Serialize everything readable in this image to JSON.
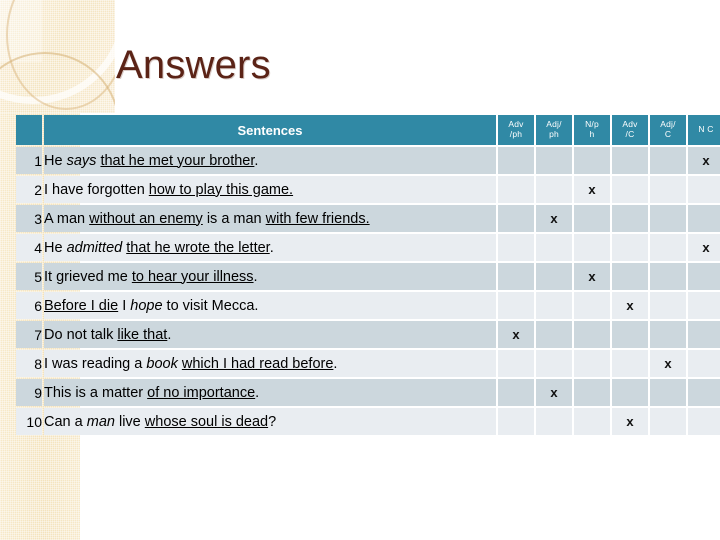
{
  "slide": {
    "title": "Answers",
    "title_color": "#5b2316",
    "accent_color": "#3089a5",
    "row_odd_color": "#ccd7dd",
    "row_even_color": "#e9edf1",
    "deco_color": "#f4e4c0"
  },
  "table": {
    "headers": {
      "number": "",
      "sentences": "Sentences",
      "marks": [
        {
          "line1": "Adv",
          "line2": "/ph",
          "full": "Adv/ph"
        },
        {
          "line1": "Adj/",
          "line2": "ph",
          "full": "Adj/ph"
        },
        {
          "line1": "N/p",
          "line2": "h",
          "full": "N/ph"
        },
        {
          "line1": "Adv",
          "line2": "/C",
          "full": "Adv/C"
        },
        {
          "line1": "Adj/",
          "line2": "C",
          "full": "Adj/C"
        },
        {
          "line1": "N C",
          "line2": "",
          "full": "N C"
        }
      ]
    },
    "mark_symbol": "x",
    "rows": [
      {
        "number": "1",
        "sentence": "He says that he met your brother.",
        "parts": [
          {
            "text": "He ",
            "style": "plain"
          },
          {
            "text": "says",
            "style": "italic"
          },
          {
            "text": " ",
            "style": "plain"
          },
          {
            "text": "that he met your brother",
            "style": "underline"
          },
          {
            "text": ".",
            "style": "plain"
          }
        ],
        "marks": [
          false,
          false,
          false,
          false,
          false,
          true
        ]
      },
      {
        "number": "2",
        "sentence": "I have forgotten how to play this game.",
        "parts": [
          {
            "text": "I have forgotten ",
            "style": "plain"
          },
          {
            "text": "how to play this game.",
            "style": "underline"
          }
        ],
        "marks": [
          false,
          false,
          true,
          false,
          false,
          false
        ]
      },
      {
        "number": "3",
        "sentence": "A man without an enemy is a man with few friends.",
        "parts": [
          {
            "text": "A man ",
            "style": "plain"
          },
          {
            "text": "without an enemy",
            "style": "underline"
          },
          {
            "text": " is a man ",
            "style": "plain"
          },
          {
            "text": "with few friends.",
            "style": "underline"
          }
        ],
        "marks": [
          false,
          true,
          false,
          false,
          false,
          false
        ]
      },
      {
        "number": "4",
        "sentence": "He admitted that he wrote the letter.",
        "parts": [
          {
            "text": "He ",
            "style": "plain"
          },
          {
            "text": "admitted",
            "style": "italic"
          },
          {
            "text": " ",
            "style": "plain"
          },
          {
            "text": "that he wrote the letter",
            "style": "underline"
          },
          {
            "text": ".",
            "style": "plain"
          }
        ],
        "marks": [
          false,
          false,
          false,
          false,
          false,
          true
        ]
      },
      {
        "number": "5",
        "sentence": "It grieved me to hear your illness.",
        "parts": [
          {
            "text": "It grieved me ",
            "style": "plain"
          },
          {
            "text": "to hear your illness",
            "style": "underline"
          },
          {
            "text": ".",
            "style": "plain"
          }
        ],
        "marks": [
          false,
          false,
          true,
          false,
          false,
          false
        ]
      },
      {
        "number": "6",
        "sentence": "Before I die I hope to visit Mecca.",
        "parts": [
          {
            "text": "Before I die",
            "style": "underline"
          },
          {
            "text": " I ",
            "style": "plain"
          },
          {
            "text": "hope",
            "style": "italic"
          },
          {
            "text": " to visit Mecca.",
            "style": "plain"
          }
        ],
        "marks": [
          false,
          false,
          false,
          true,
          false,
          false
        ]
      },
      {
        "number": "7",
        "sentence": "Do not talk like that.",
        "parts": [
          {
            "text": "Do not talk ",
            "style": "plain"
          },
          {
            "text": "like that",
            "style": "underline"
          },
          {
            "text": ".",
            "style": "plain"
          }
        ],
        "marks": [
          true,
          false,
          false,
          false,
          false,
          false
        ]
      },
      {
        "number": "8",
        "sentence": "I was reading a book which I had read before.",
        "parts": [
          {
            "text": "I was reading a ",
            "style": "plain"
          },
          {
            "text": "book",
            "style": "italic"
          },
          {
            "text": " ",
            "style": "plain"
          },
          {
            "text": "which I had read before",
            "style": "underline"
          },
          {
            "text": ".",
            "style": "plain"
          }
        ],
        "marks": [
          false,
          false,
          false,
          false,
          true,
          false
        ]
      },
      {
        "number": "9",
        "sentence": "This is a matter of no importance.",
        "parts": [
          {
            "text": "This is a matter ",
            "style": "plain"
          },
          {
            "text": "of no importance",
            "style": "underline"
          },
          {
            "text": ".",
            "style": "plain"
          }
        ],
        "marks": [
          false,
          true,
          false,
          false,
          false,
          false
        ]
      },
      {
        "number": "10",
        "sentence": "Can a man live whose soul is dead?",
        "parts": [
          {
            "text": "Can a ",
            "style": "plain"
          },
          {
            "text": "man",
            "style": "italic"
          },
          {
            "text": " live ",
            "style": "plain"
          },
          {
            "text": "whose soul is dead",
            "style": "underline"
          },
          {
            "text": "?",
            "style": "plain"
          }
        ],
        "marks": [
          false,
          false,
          false,
          true,
          false,
          false
        ]
      }
    ]
  }
}
